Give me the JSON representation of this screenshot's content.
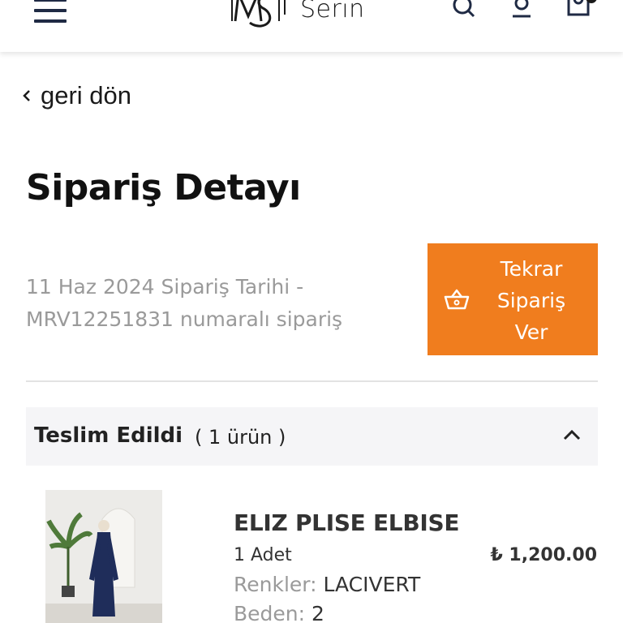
{
  "header": {
    "brand_text": "Serin",
    "logo_mark": "MS",
    "icons": [
      "menu-icon",
      "search-icon",
      "user-icon",
      "cart-icon"
    ]
  },
  "back": {
    "label": "geri dön"
  },
  "page": {
    "title": "Sipariş Detayı"
  },
  "order": {
    "line1": "11 Haz 2024 Sipariş Tarihi -",
    "line2": "MRV12251831 numaralı sipariş"
  },
  "reorder": {
    "label_lines": [
      "Tekrar",
      "Sipariş",
      "Ver"
    ],
    "icon": "basket-icon",
    "color": "#f07d1e"
  },
  "shipment": {
    "status": "Teslim Edildi",
    "count_label": "( 1 ürün )",
    "expanded": true
  },
  "product": {
    "name": "ELIZ PLISE ELBISE",
    "quantity": "1 Adet",
    "price": "₺ 1,200.00",
    "color_label": "Renkler:",
    "color_value": "LACIVERT",
    "size_label": "Beden:",
    "size_value": "2"
  },
  "colors": {
    "accent": "#f07d1e",
    "text_muted": "#9a9a9a",
    "panel": "#f5f5f7"
  }
}
